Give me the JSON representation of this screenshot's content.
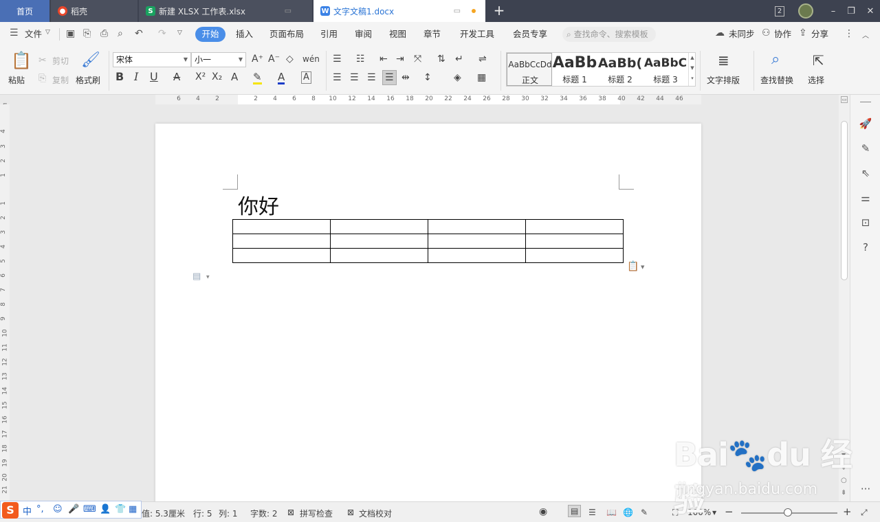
{
  "colors": {
    "accent": "#4a8ee8",
    "titlebar": "#3d4250",
    "tab_active_text": "#2a74d5",
    "modified_dot": "#f5a623"
  },
  "tabs": [
    {
      "label": "首页"
    },
    {
      "label": "稻壳",
      "icon": "daoke-icon"
    },
    {
      "label": "新建 XLSX 工作表.xlsx",
      "icon": "spreadsheet-icon"
    },
    {
      "label": "文字文稿1.docx",
      "icon": "writer-icon"
    }
  ],
  "titlebar": {
    "badge": "2"
  },
  "menu": {
    "file": "文件",
    "items": [
      "开始",
      "插入",
      "页面布局",
      "引用",
      "审阅",
      "视图",
      "章节",
      "开发工具",
      "会员专享"
    ],
    "search_placeholder": "查找命令、搜索模板",
    "sync": "未同步",
    "collab": "协作",
    "share": "分享"
  },
  "ribbon": {
    "paste": "粘贴",
    "cut": "剪切",
    "copy": "复制",
    "format_painter": "格式刷",
    "font_name": "宋体",
    "font_size": "小一",
    "styles": [
      {
        "sample": "AaBbCcDd",
        "name": "正文"
      },
      {
        "sample": "AaBb",
        "name": "标题 1"
      },
      {
        "sample": "AaBb(",
        "name": "标题 2"
      },
      {
        "sample": "AaBbC",
        "name": "标题 3"
      }
    ],
    "text_layout": "文字排版",
    "find_replace": "查找替换",
    "select": "选择"
  },
  "ruler": {
    "h_ticks": [
      "6",
      "4",
      "2",
      "2",
      "4",
      "6",
      "8",
      "10",
      "12",
      "14",
      "16",
      "18",
      "20",
      "22",
      "24",
      "26",
      "28",
      "30",
      "32",
      "34",
      "36",
      "38",
      "40",
      "42",
      "44",
      "46"
    ],
    "v_ticks": [
      "4",
      "3",
      "2",
      "1",
      "1",
      "2",
      "3",
      "4",
      "5",
      "6",
      "7",
      "8",
      "9",
      "10",
      "11",
      "12",
      "13",
      "14",
      "15",
      "16",
      "17",
      "18",
      "19",
      "20",
      "21"
    ]
  },
  "document": {
    "heading": "你好",
    "table": {
      "rows": 3,
      "cols": 4
    }
  },
  "status": {
    "position": "值: 5.3厘米",
    "line": "行: 5",
    "col": "列: 1",
    "word_count": "字数: 2",
    "spell_check": "拼写检查",
    "doc_proof": "文档校对",
    "zoom": "100%",
    "zoom_level_percent": 100
  },
  "ime": {
    "lang": "中"
  },
  "watermark": {
    "logo": "Bai du 经验",
    "url": "jingyan.baidu.com"
  }
}
